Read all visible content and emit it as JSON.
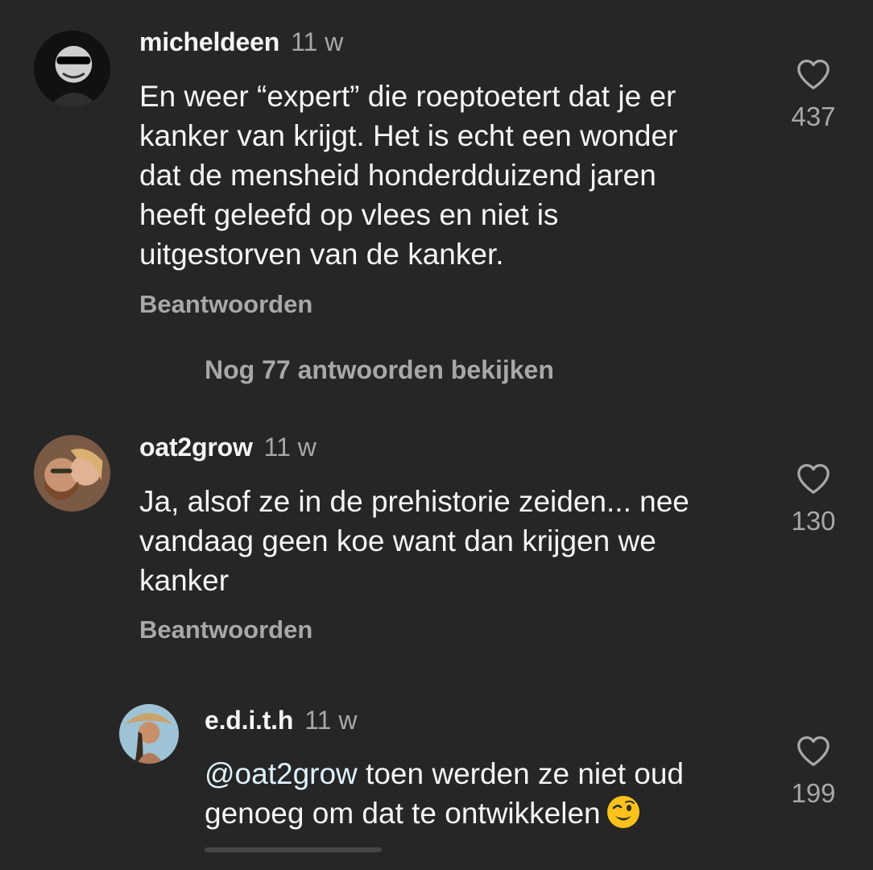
{
  "comments": [
    {
      "username": "micheldeen",
      "time": "11 w",
      "lines": [
        "En weer “expert” die roeptoetert dat je er",
        "kanker van krijgt. Het is echt een wonder",
        "dat de mensheid honderdduizend jaren",
        "heeft geleefd op vlees en niet is",
        "uitgestorven van de kanker."
      ],
      "likes": "437",
      "reply_label": "Beantwoorden"
    },
    {
      "username": "oat2grow",
      "time": "11 w",
      "lines": [
        "Ja, alsof ze in de prehistorie zeiden... nee",
        "vandaag geen koe want dan krijgen we",
        "kanker"
      ],
      "likes": "130",
      "reply_label": "Beantwoorden"
    },
    {
      "username": "e.d.i.t.h",
      "time": "11 w",
      "mention": "@oat2grow",
      "line1_rest": " toen werden ze niet oud",
      "line2": "genoeg om dat te ontwikkelen",
      "emoji": "winking-face-emoji",
      "likes": "199"
    }
  ],
  "more_replies": "Nog 77 antwoorden bekijken",
  "icons": {
    "like": "heart-icon"
  },
  "colors": {
    "background": "#262626",
    "primary_text": "#f5f5f5",
    "secondary_text": "#a8a8a8",
    "mention": "#e0f1ff"
  }
}
